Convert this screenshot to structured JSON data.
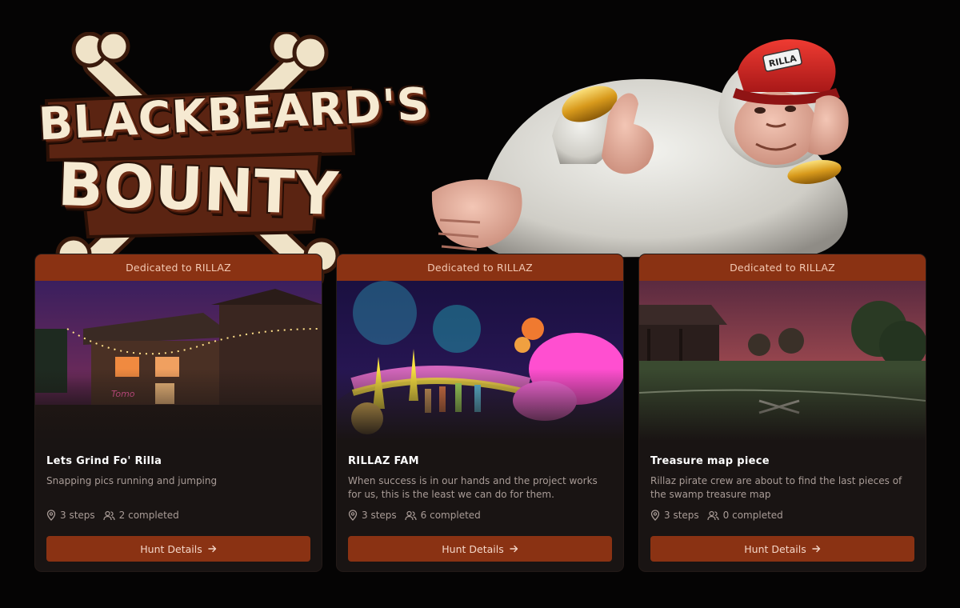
{
  "logo": {
    "line1": "BLACKBEARD'S",
    "line2": "BOUNTY"
  },
  "mascot": {
    "cap_text": "RILLA"
  },
  "colors": {
    "background": "#050404",
    "card": "#191413",
    "accent": "#8a3213",
    "muted_text": "#a99c97"
  },
  "cards": [
    {
      "dedicated": "Dedicated to RILLAZ",
      "title": "Lets Grind Fo' Rilla",
      "description": "Snapping pics running and jumping",
      "steps": "3 steps",
      "completed": "2 completed",
      "button": "Hunt Details",
      "image": "night tavern scene with string lights"
    },
    {
      "dedicated": "Dedicated to RILLAZ",
      "title": "RILLAZ FAM",
      "description": "When success is in our hands and the project works for us, this is the least we can do for them.",
      "steps": "3 steps",
      "completed": "6 completed",
      "button": "Hunt Details",
      "image": "neon psychedelic world with avatars"
    },
    {
      "dedicated": "Dedicated to RILLAZ",
      "title": "Treasure map piece",
      "description": "Rillaz pirate crew are about to find the last pieces of the swamp treasure map",
      "steps": "3 steps",
      "completed": "0 completed",
      "button": "Hunt Details",
      "image": "swamp field at dusk with X mark"
    }
  ],
  "icons": {
    "steps": "map-pin-icon",
    "completed": "users-icon",
    "button": "arrow-right-icon"
  }
}
